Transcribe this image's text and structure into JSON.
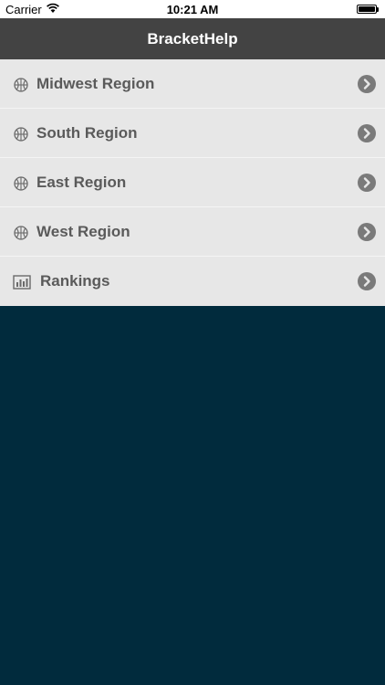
{
  "status_bar": {
    "carrier": "Carrier",
    "time": "10:21 AM"
  },
  "nav": {
    "title": "BracketHelp"
  },
  "menu": {
    "items": [
      {
        "label": "Midwest Region",
        "icon": "basketball-icon"
      },
      {
        "label": "South Region",
        "icon": "basketball-icon"
      },
      {
        "label": "East Region",
        "icon": "basketball-icon"
      },
      {
        "label": "West Region",
        "icon": "basketball-icon"
      },
      {
        "label": "Rankings",
        "icon": "bar-chart-icon"
      }
    ]
  },
  "colors": {
    "nav_background": "#434343",
    "menu_background": "#e7e7e7",
    "content_background": "#012b3d",
    "label_text": "#5a5a5a",
    "chevron": "#7a7a7a"
  }
}
